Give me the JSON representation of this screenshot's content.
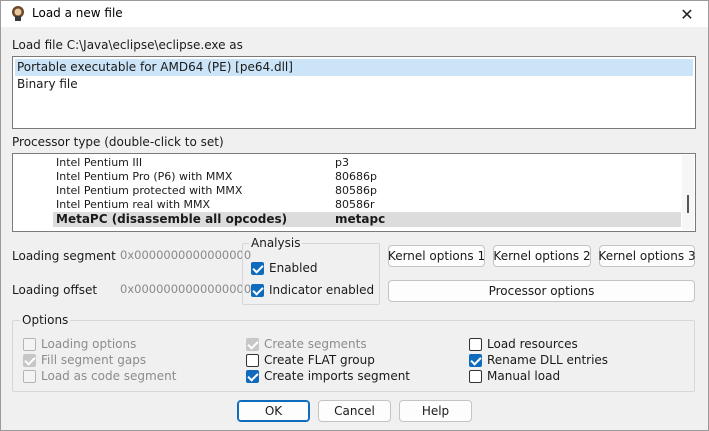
{
  "window": {
    "title": "Load a new file",
    "close_glyph": "✕"
  },
  "load_file": {
    "label": "Load file C:\\Java\\eclipse\\eclipse.exe as",
    "formats": [
      {
        "label": "Portable executable for AMD64 (PE) [pe64.dll]",
        "selected": true
      },
      {
        "label": "Binary file",
        "selected": false
      }
    ]
  },
  "processor": {
    "label": "Processor type (double-click to set)",
    "rows": [
      {
        "name": "Intel Pentium III",
        "code": "p3"
      },
      {
        "name": "Intel Pentium Pro (P6) with MMX",
        "code": "80686p"
      },
      {
        "name": "Intel Pentium protected with MMX",
        "code": "80586p"
      },
      {
        "name": "Intel Pentium real with MMX",
        "code": "80586r"
      },
      {
        "name": "MetaPC (disassemble all opcodes)",
        "code": "metapc",
        "selected": true
      }
    ]
  },
  "loading": {
    "segment_label": "Loading segment",
    "segment_value": "0x0000000000000000",
    "offset_label": "Loading offset",
    "offset_value": "0x0000000000000000"
  },
  "analysis": {
    "title": "Analysis",
    "enabled_label": "Enabled",
    "enabled": true,
    "indicator_label": "Indicator enabled",
    "indicator": true
  },
  "buttons": {
    "kernel1": "Kernel options 1",
    "kernel2": "Kernel options 2",
    "kernel3": "Kernel options 3",
    "processor_options": "Processor options",
    "ok": "OK",
    "cancel": "Cancel",
    "help": "Help"
  },
  "options": {
    "title": "Options",
    "col1": [
      {
        "label": "Loading options",
        "checked": false,
        "disabled": true
      },
      {
        "label": "Fill segment gaps",
        "checked": true,
        "disabled": true
      },
      {
        "label": "Load as code segment",
        "checked": false,
        "disabled": true
      }
    ],
    "col2": [
      {
        "label": "Create segments",
        "checked": true,
        "disabled": true
      },
      {
        "label": "Create FLAT group",
        "checked": false,
        "disabled": false
      },
      {
        "label": "Create imports segment",
        "checked": true,
        "disabled": false
      }
    ],
    "col3": [
      {
        "label": "Load resources",
        "checked": false,
        "disabled": false
      },
      {
        "label": "Rename DLL entries",
        "checked": true,
        "disabled": false
      },
      {
        "label": "Manual load",
        "checked": false,
        "disabled": false
      }
    ]
  },
  "icons": {
    "app": "ida-app-icon",
    "close": "close-icon"
  }
}
